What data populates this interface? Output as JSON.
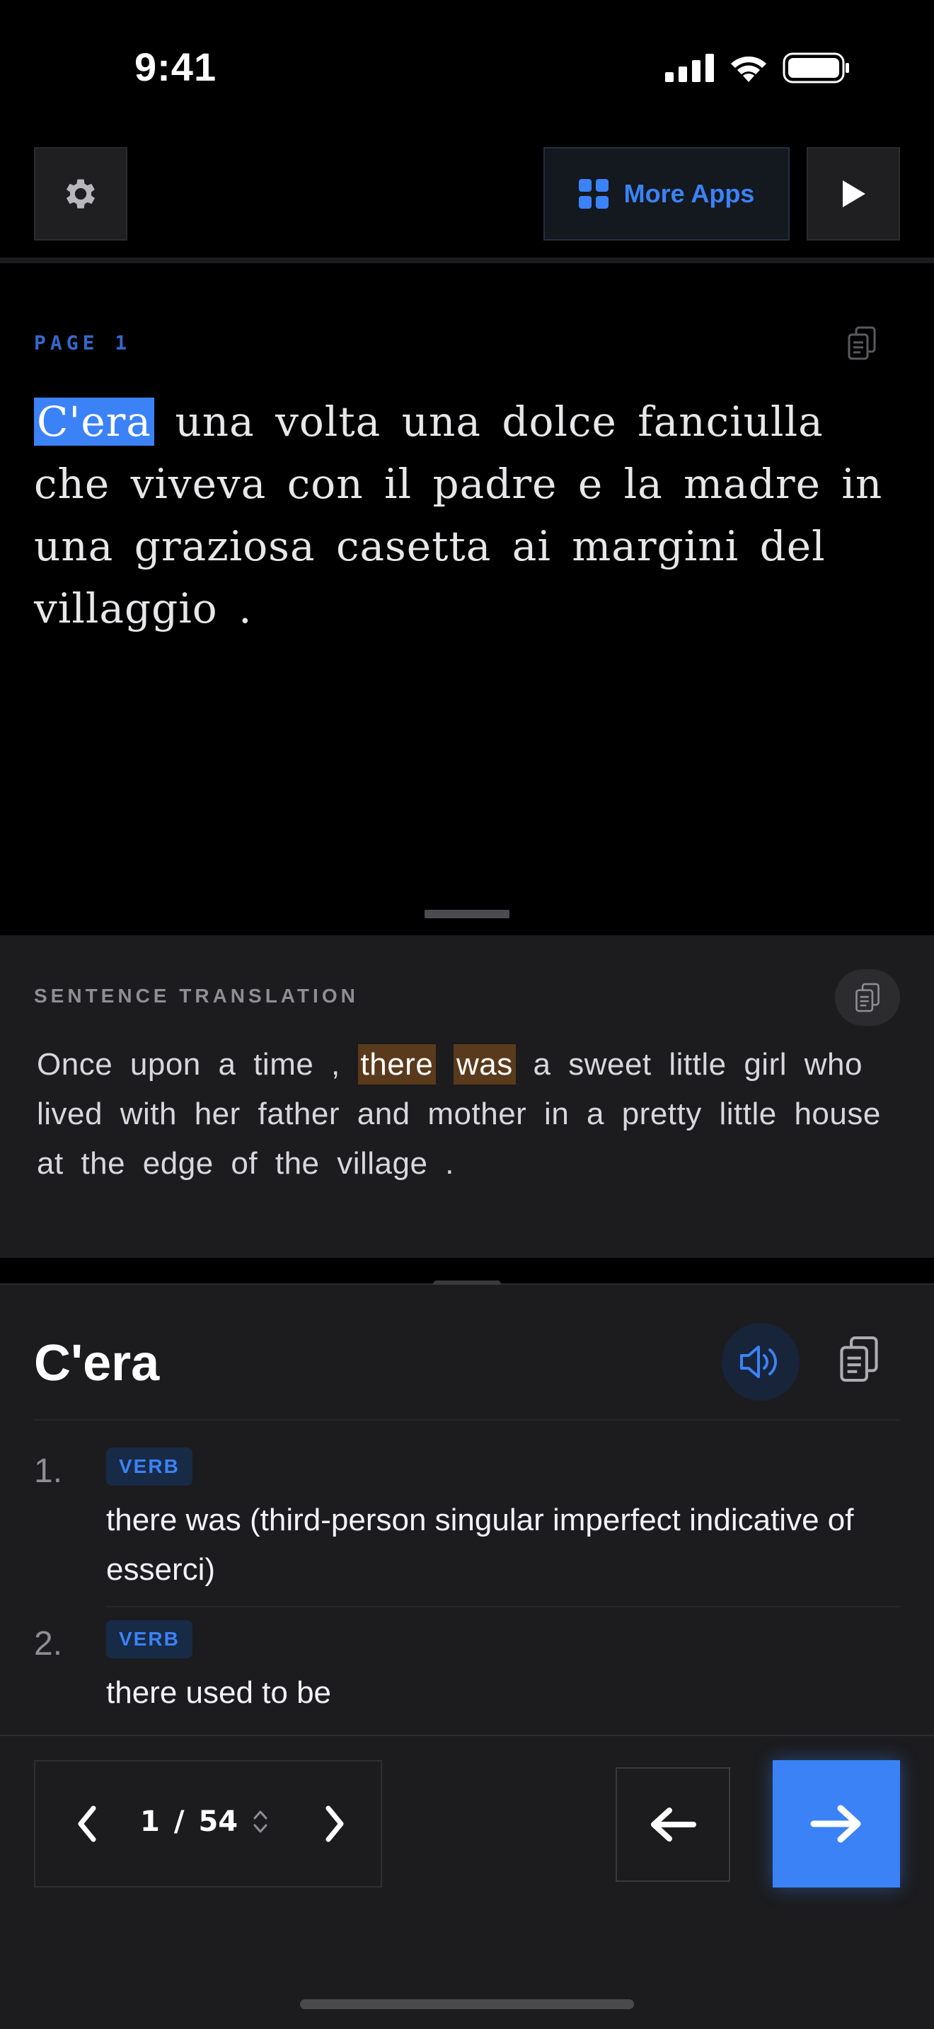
{
  "status_bar": {
    "time": "9:41"
  },
  "toolbar": {
    "more_apps_label": "More Apps"
  },
  "story": {
    "page_label": "PAGE 1",
    "highlighted_word": "C'era",
    "text_rest": " una volta una dolce fanciulla che viveva con il padre e la madre in una graziosa casetta ai margini del villaggio ."
  },
  "translation": {
    "label": "SENTENCE TRANSLATION",
    "before": "Once upon a time , ",
    "hl_1": "there",
    "hl_2": "was",
    "after": " a sweet little girl who lived with her father and mother in a pretty little house at the edge of the village ."
  },
  "dictionary": {
    "word": "C'era",
    "definitions": [
      {
        "number": "1.",
        "pos": "VERB",
        "text": "there was (third-person singular imperfect indicative of esserci)"
      },
      {
        "number": "2.",
        "pos": "VERB",
        "text": "there used to be"
      }
    ]
  },
  "pager": {
    "current": "1",
    "separator": "/",
    "total": "54"
  },
  "colors": {
    "accent": "#3b82f6",
    "highlight_brown": "#5a3a1c",
    "panel": "#1c1c1e"
  },
  "icons": [
    "gear-icon",
    "grid-icon",
    "play-icon",
    "copy-icon",
    "speaker-icon",
    "chevron-left-icon",
    "chevron-right-icon",
    "arrow-left-icon",
    "arrow-right-icon",
    "sort-icon"
  ]
}
